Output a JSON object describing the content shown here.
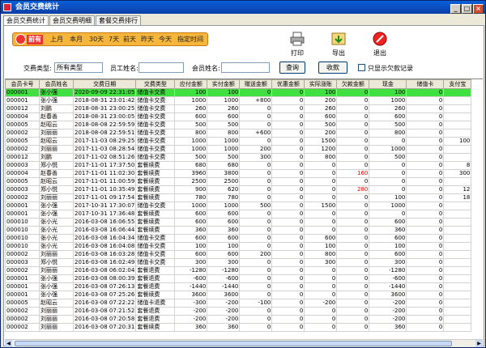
{
  "window": {
    "title": "会员交费统计",
    "minimize": "_",
    "maximize": "□",
    "close": "×"
  },
  "tabs": [
    "会员交费统计",
    "会员交费明细",
    "套餐交费排行"
  ],
  "filter": {
    "selected": "前有",
    "items": [
      "上月",
      "本月",
      "30天",
      "7天",
      "前天",
      "昨天",
      "今天",
      "指定时间"
    ]
  },
  "toolbar": {
    "print": "打印",
    "export": "导出",
    "exit": "退出"
  },
  "search": {
    "type_label": "交费类型:",
    "type_value": "所有类型",
    "staff_label": "员工姓名:",
    "staff_value": "",
    "member_label": "会员姓名:",
    "member_value": "",
    "query_button": "查询",
    "collapse_button": "收款",
    "only_arrears_label": "只显示欠款记录"
  },
  "table": {
    "columns": [
      "会员卡号",
      "会员姓名",
      "交费日期",
      "交费类型",
      "应付金额",
      "实付金额",
      "赠送金额",
      "优惠金额",
      "实际涨账",
      "欠款金额",
      "现金",
      "储值卡",
      "支付宝"
    ],
    "rows": [
      [
        "000001",
        "张小强",
        "2020-09-09 22:31:05",
        "储值卡交费",
        "100",
        "100",
        "0",
        "0",
        "100",
        "0",
        "100",
        "0",
        ""
      ],
      [
        "000001",
        "张小强",
        "2018-08-31 23:01:42",
        "储值卡交费",
        "1000",
        "1000",
        "+800",
        "0",
        "200",
        "0",
        "1000",
        "0",
        ""
      ],
      [
        "000012",
        "刘鹏",
        "2018-08-31 23:00:25",
        "储值卡交费",
        "260",
        "260",
        "0",
        "0",
        "260",
        "0",
        "260",
        "0",
        ""
      ],
      [
        "000004",
        "赵春善",
        "2018-08-31 23:00:05",
        "储值卡交费",
        "600",
        "600",
        "0",
        "0",
        "600",
        "0",
        "600",
        "0",
        ""
      ],
      [
        "000005",
        "赵昭云",
        "2018-08-08 22:59:59",
        "储值卡交费",
        "500",
        "500",
        "0",
        "0",
        "500",
        "0",
        "500",
        "0",
        ""
      ],
      [
        "000002",
        "刘丽丽",
        "2018-08-08 22:59:51",
        "储值卡交费",
        "800",
        "800",
        "+600",
        "0",
        "200",
        "0",
        "800",
        "0",
        ""
      ],
      [
        "000005",
        "赵昭云",
        "2017-11-03 08:29:25",
        "储值卡交费",
        "1000",
        "1000",
        "0",
        "0",
        "1500",
        "0",
        "0",
        "0",
        "100"
      ],
      [
        "000002",
        "刘丽丽",
        "2017-11-03 08:28:54",
        "储值卡交费",
        "1000",
        "1000",
        "200",
        "0",
        "1200",
        "0",
        "1000",
        "0",
        ""
      ],
      [
        "000012",
        "刘鹏",
        "2017-11-02 08:51:26",
        "储值卡交费",
        "500",
        "500",
        "300",
        "0",
        "800",
        "0",
        "500",
        "0",
        ""
      ],
      [
        "000003",
        "郑小悦",
        "2017-11-01 17:37:50",
        "套餐续费",
        "680",
        "680",
        "0",
        "0",
        "0",
        "0",
        "0",
        "0",
        "8"
      ],
      [
        "000004",
        "赵春善",
        "2017-11-01 11:02:30",
        "套餐续费",
        "3960",
        "3800",
        "0",
        "0",
        "0",
        "160",
        "0",
        "0",
        "300"
      ],
      [
        "000005",
        "赵昭云",
        "2017-11-01 11:00:59",
        "套餐续费",
        "2500",
        "2500",
        "0",
        "0",
        "0",
        "0",
        "0",
        "0",
        ""
      ],
      [
        "000003",
        "郑小悦",
        "2017-11-01 10:35:49",
        "套餐续费",
        "900",
        "620",
        "0",
        "0",
        "0",
        "280",
        "0",
        "0",
        "12"
      ],
      [
        "000002",
        "刘丽丽",
        "2017-11-01 09:17:54",
        "套餐续费",
        "780",
        "780",
        "0",
        "0",
        "0",
        "0",
        "100",
        "0",
        "18"
      ],
      [
        "000001",
        "张小强",
        "2017-10-31 17:30:07",
        "储值卡交费",
        "1000",
        "1000",
        "500",
        "0",
        "1500",
        "0",
        "1000",
        "0",
        ""
      ],
      [
        "000001",
        "张小强",
        "2017-10-31 17:36:48",
        "套餐续费",
        "600",
        "600",
        "0",
        "0",
        "0",
        "0",
        "0",
        "0",
        ""
      ],
      [
        "000010",
        "张小光",
        "2016-03-08 16:06:55",
        "套餐续费",
        "600",
        "600",
        "0",
        "0",
        "0",
        "0",
        "600",
        "0",
        ""
      ],
      [
        "000010",
        "张小光",
        "2016-03-08 16:06:44",
        "套餐续费",
        "360",
        "360",
        "0",
        "0",
        "0",
        "0",
        "360",
        "0",
        ""
      ],
      [
        "000010",
        "张小光",
        "2016-03-08 16:04:34",
        "储值卡交费",
        "600",
        "600",
        "0",
        "0",
        "600",
        "0",
        "600",
        "0",
        ""
      ],
      [
        "000010",
        "张小光",
        "2016-03-08 16:04:08",
        "储值卡交费",
        "100",
        "100",
        "0",
        "0",
        "100",
        "0",
        "100",
        "0",
        ""
      ],
      [
        "000002",
        "刘丽丽",
        "2016-03-08 16:03:28",
        "储值卡交费",
        "600",
        "600",
        "200",
        "0",
        "800",
        "0",
        "600",
        "0",
        ""
      ],
      [
        "000003",
        "郑小悦",
        "2016-03-08 16:02:49",
        "储值卡交费",
        "300",
        "300",
        "0",
        "0",
        "300",
        "0",
        "300",
        "0",
        ""
      ],
      [
        "000002",
        "刘丽丽",
        "2016-03-08 06:02:04",
        "套餐退费",
        "-1280",
        "-1280",
        "0",
        "0",
        "0",
        "0",
        "-1280",
        "0",
        ""
      ],
      [
        "000001",
        "张小强",
        "2016-03-08 08:00:39",
        "套餐退费",
        "-600",
        "-600",
        "0",
        "0",
        "0",
        "0",
        "-600",
        "0",
        ""
      ],
      [
        "000001",
        "张小强",
        "2016-03-08 07:26:13",
        "套餐退费",
        "-1440",
        "-1440",
        "0",
        "0",
        "0",
        "0",
        "-1440",
        "0",
        ""
      ],
      [
        "000001",
        "张小强",
        "2016-03-08 07:25:26",
        "套餐续费",
        "3600",
        "3600",
        "0",
        "0",
        "0",
        "0",
        "3600",
        "0",
        ""
      ],
      [
        "000005",
        "赵昭云",
        "2016-03-08 07:22:22",
        "储值卡退费",
        "-300",
        "-200",
        "-100",
        "0",
        "-200",
        "0",
        "-200",
        "0",
        ""
      ],
      [
        "000002",
        "刘丽丽",
        "2016-03-08 07:21:52",
        "套餐退费",
        "-200",
        "-200",
        "0",
        "0",
        "0",
        "0",
        "-200",
        "0",
        ""
      ],
      [
        "000002",
        "刘丽丽",
        "2016-03-08 07:20:58",
        "套餐退费",
        "-200",
        "-200",
        "0",
        "0",
        "0",
        "0",
        "-200",
        "0",
        ""
      ],
      [
        "000002",
        "刘丽丽",
        "2016-03-08 07:20:31",
        "套餐续费",
        "360",
        "360",
        "0",
        "0",
        "0",
        "0",
        "360",
        "0",
        ""
      ]
    ]
  },
  "colors": {
    "selected_row": "#40e040",
    "filter_bar": "#f6b63b",
    "arrears": "#e00000"
  }
}
